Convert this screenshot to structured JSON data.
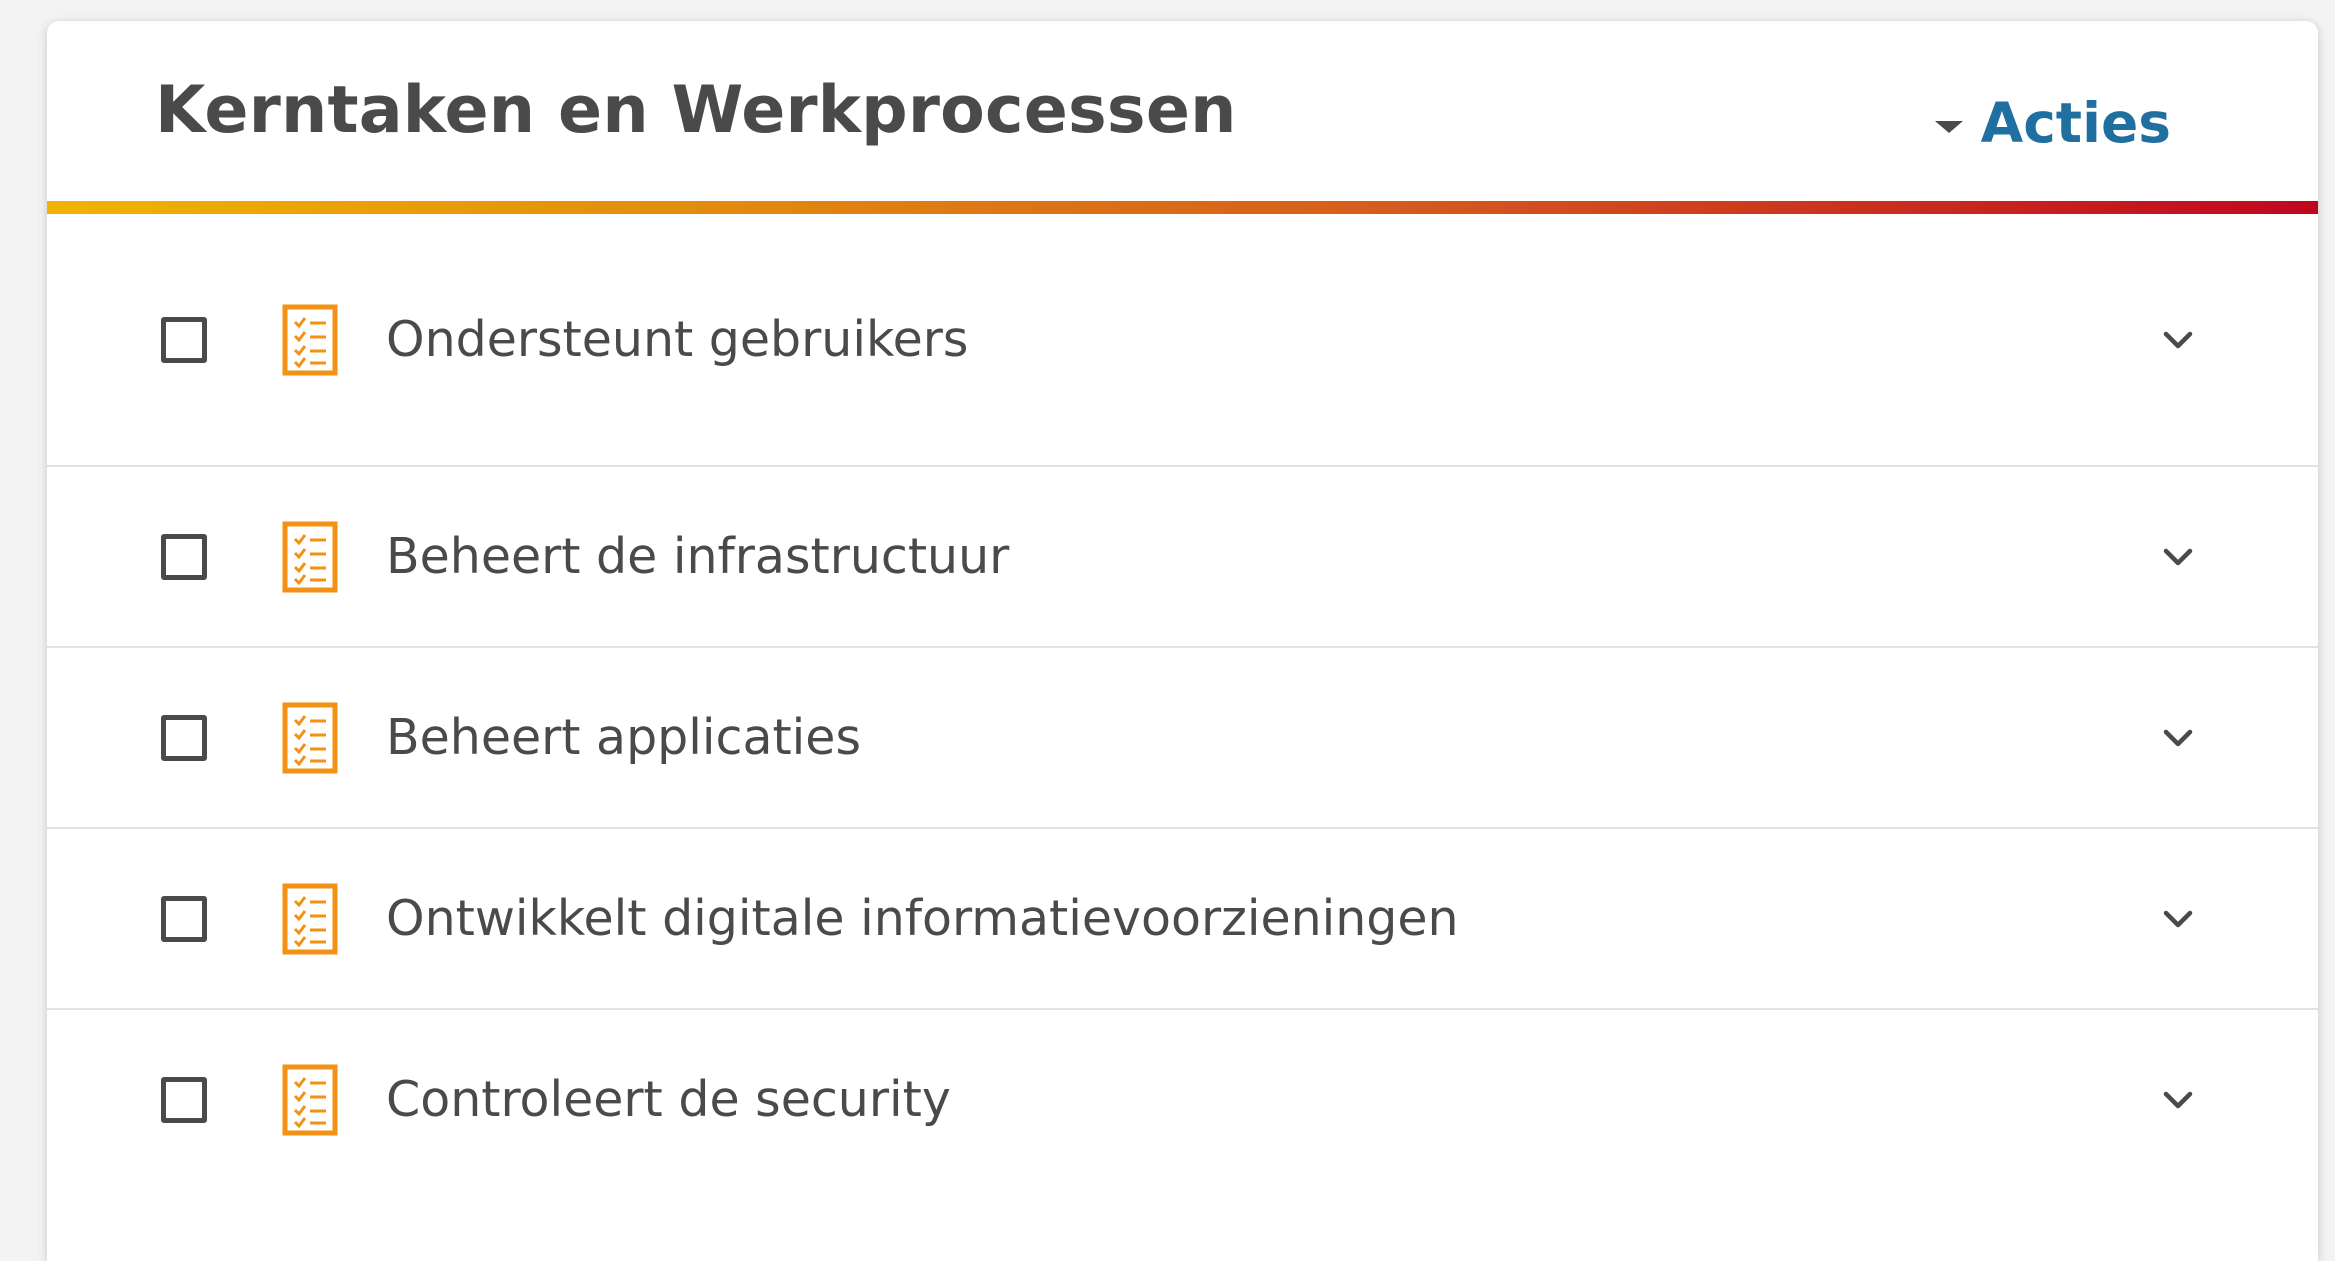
{
  "header": {
    "title": "Kerntaken en Werkprocessen",
    "actions_label": "Acties"
  },
  "colors": {
    "accent_link": "#1f6fa0",
    "icon_orange": "#f29114",
    "gradient_start": "#f0b400",
    "gradient_end": "#c0061f"
  },
  "tasks": [
    {
      "label": "Ondersteunt gebruikers",
      "checked": false,
      "icon": "checklist-icon",
      "expand_icon": "chevron-down-icon"
    },
    {
      "label": "Beheert de infrastructuur",
      "checked": false,
      "icon": "checklist-icon",
      "expand_icon": "chevron-down-icon"
    },
    {
      "label": "Beheert applicaties",
      "checked": false,
      "icon": "checklist-icon",
      "expand_icon": "chevron-down-icon"
    },
    {
      "label": "Ontwikkelt digitale informatievoorzieningen",
      "checked": false,
      "icon": "checklist-icon",
      "expand_icon": "chevron-down-icon"
    },
    {
      "label": "Controleert de security",
      "checked": false,
      "icon": "checklist-icon",
      "expand_icon": "chevron-down-icon"
    }
  ]
}
